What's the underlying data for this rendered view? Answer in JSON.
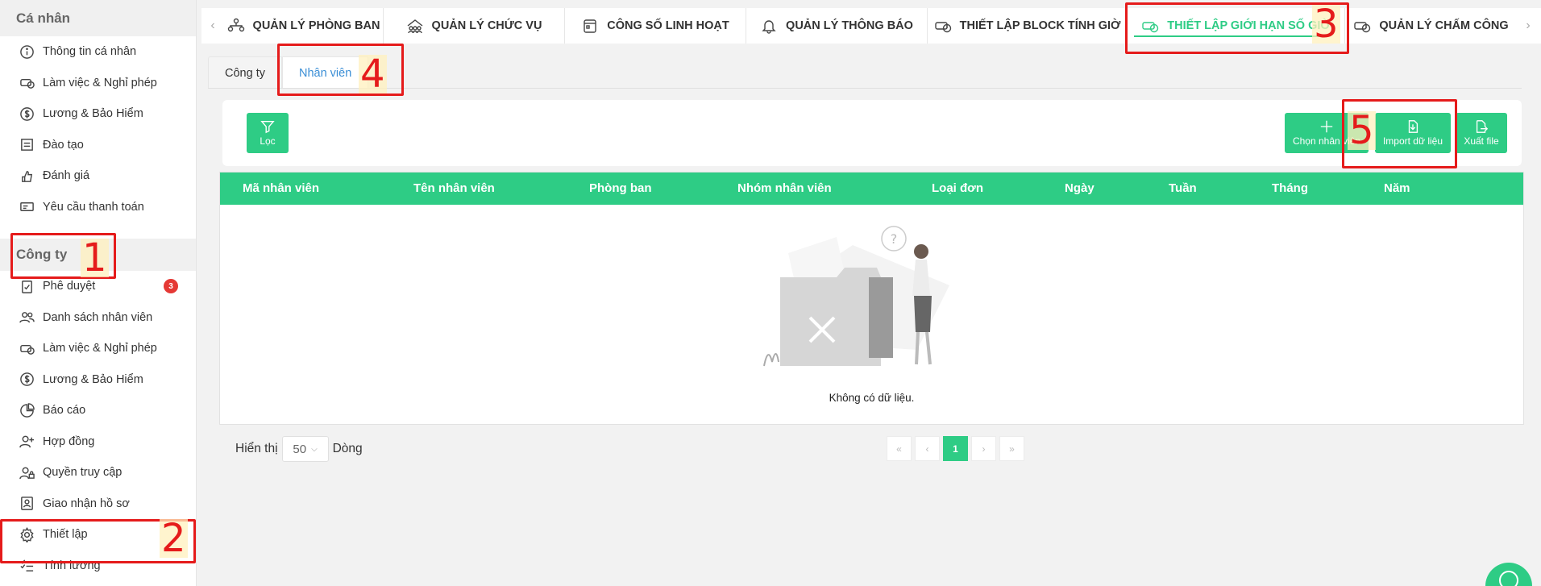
{
  "sidebar": {
    "personal_header": "Cá nhân",
    "personal_items": [
      {
        "label": "Thông tin cá nhân",
        "icon": "info-icon"
      },
      {
        "label": "Làm việc & Nghỉ phép",
        "icon": "car-clock-icon"
      },
      {
        "label": "Lương & Bảo Hiểm",
        "icon": "dollar-icon"
      },
      {
        "label": "Đào tạo",
        "icon": "training-icon"
      },
      {
        "label": "Đánh giá",
        "icon": "rating-icon"
      },
      {
        "label": "Yêu cầu thanh toán",
        "icon": "payment-icon"
      }
    ],
    "company_header": "Công ty",
    "company_items": [
      {
        "label": "Phê duyệt",
        "icon": "approve-icon",
        "badge": "3"
      },
      {
        "label": "Danh sách nhân viên",
        "icon": "users-icon"
      },
      {
        "label": "Làm việc & Nghỉ phép",
        "icon": "car-clock-icon"
      },
      {
        "label": "Lương & Bảo Hiểm",
        "icon": "dollar-icon"
      },
      {
        "label": "Báo cáo",
        "icon": "pie-chart-icon"
      },
      {
        "label": "Hợp đồng",
        "icon": "user-plus-icon"
      },
      {
        "label": "Quyền truy cập",
        "icon": "user-lock-icon"
      },
      {
        "label": "Giao nhận hồ sơ",
        "icon": "profile-icon"
      },
      {
        "label": "Thiết lập",
        "icon": "gear-icon"
      },
      {
        "label": "Tính lương",
        "icon": "checklist-icon"
      }
    ]
  },
  "tabs": [
    {
      "label": "QUẢN LÝ PHÒNG BAN",
      "icon": "department-icon"
    },
    {
      "label": "QUẢN LÝ CHỨC VỤ",
      "icon": "position-icon"
    },
    {
      "label": "CÔNG SỐ LINH HOẠT",
      "icon": "calendar-icon"
    },
    {
      "label": "QUẢN LÝ THÔNG BÁO",
      "icon": "bell-icon"
    },
    {
      "label": "THIẾT LẬP BLOCK TÍNH GIỜ",
      "icon": "car-clock-icon"
    },
    {
      "label": "THIẾT LẬP GIỚI HẠN SỐ GIỜ",
      "icon": "car-clock-icon",
      "active": true
    },
    {
      "label": "QUẢN LÝ CHẤM CÔNG",
      "icon": "car-clock-icon"
    }
  ],
  "subtabs": {
    "company": "Công ty",
    "employee": "Nhân viên"
  },
  "toolbar": {
    "filter": "Lọc",
    "choose_employee": "Chọn nhân viên",
    "import": "Import dữ liệu",
    "export": "Xuất file"
  },
  "table": {
    "columns": [
      "Mã nhân viên",
      "Tên nhân viên",
      "Phòng ban",
      "Nhóm nhân viên",
      "Loại đơn",
      "Ngày",
      "Tuần",
      "Tháng",
      "Năm"
    ],
    "empty_text": "Không có dữ liệu."
  },
  "pagination": {
    "show_label": "Hiển thị",
    "page_size": "50",
    "rows_label": "Dòng",
    "current_page": "1",
    "first": "«",
    "prev": "‹",
    "next": "›",
    "last": "»"
  },
  "annotations": [
    "1",
    "2",
    "3",
    "4",
    "5"
  ],
  "colors": {
    "accent": "#2ecc85",
    "annotation": "#e51b1b",
    "link": "#3a8ed6"
  }
}
